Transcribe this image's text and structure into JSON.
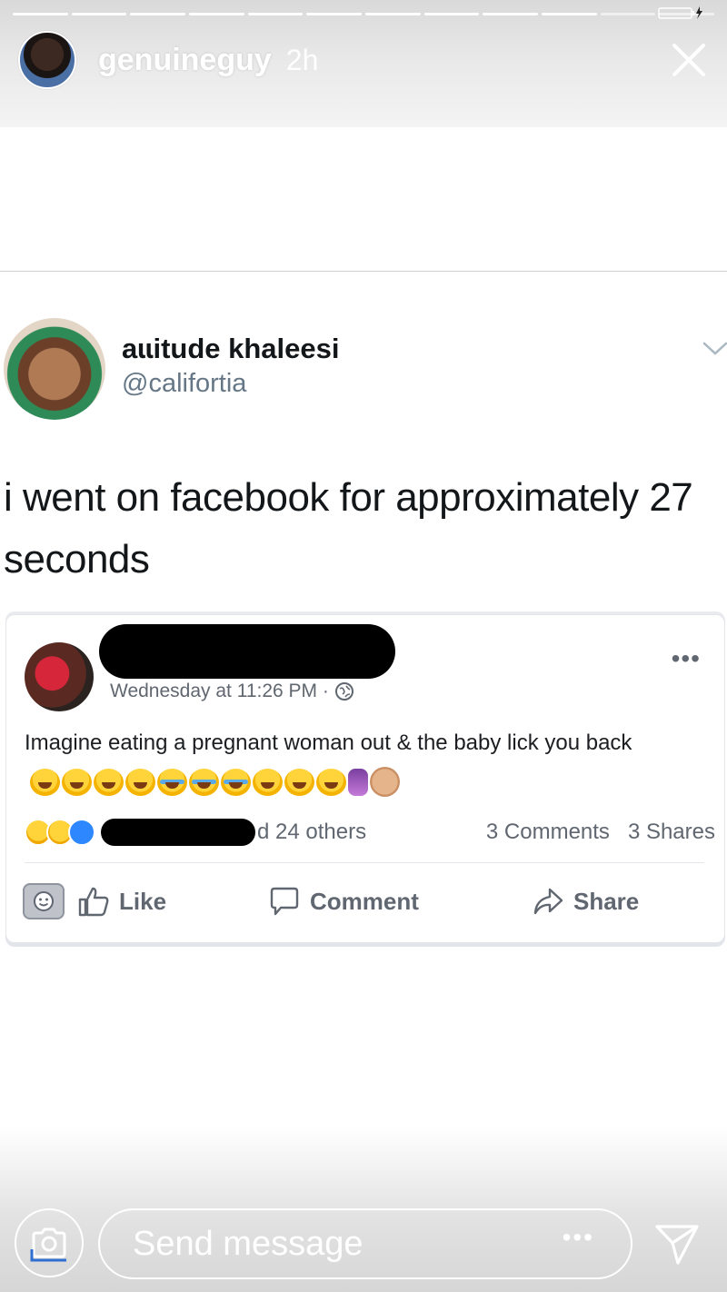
{
  "story": {
    "username": "genuineguy",
    "time": "2h",
    "progress_total": 12,
    "progress_done": 12
  },
  "tweet": {
    "display_name": "aɩɩitude khaleesi",
    "handle": "@califortia",
    "text": "i went on facebook for approximately 27 seconds"
  },
  "fb_post": {
    "timestamp": "Wednesday at 11:26 PM · ",
    "text": "Imagine eating a pregnant woman out & the baby lick you back",
    "reactions_suffix": "d 24 others",
    "comments": "3 Comments",
    "shares": "3 Shares",
    "actions": {
      "like": "Like",
      "comment": "Comment",
      "share": "Share"
    }
  },
  "footer": {
    "message_placeholder": "Send message"
  },
  "colors": {
    "fb_gray": "#606770",
    "twitter_gray": "#657786",
    "fb_blue": "#1877f2"
  }
}
